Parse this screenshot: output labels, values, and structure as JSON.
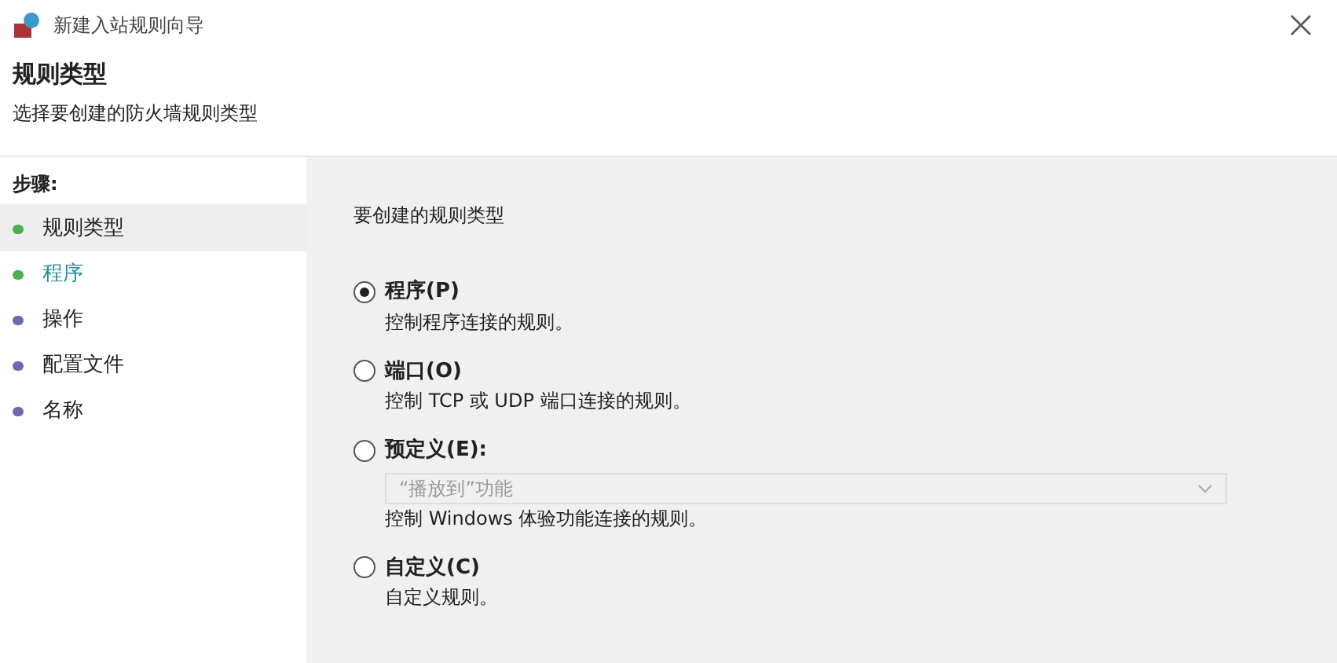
{
  "window": {
    "title": "新建入站规则向导"
  },
  "header": {
    "title": "规则类型",
    "subtitle": "选择要创建的防火墙规则类型"
  },
  "steps": {
    "heading": "步骤:",
    "items": [
      {
        "label": "规则类型",
        "selected": true,
        "active": false,
        "color": "#4caf50"
      },
      {
        "label": "程序",
        "selected": false,
        "active": true,
        "color": "#4caf50"
      },
      {
        "label": "操作",
        "selected": false,
        "active": false,
        "color": "#6a6ab0"
      },
      {
        "label": "配置文件",
        "selected": false,
        "active": false,
        "color": "#6a6ab0"
      },
      {
        "label": "名称",
        "selected": false,
        "active": false,
        "color": "#6a6ab0"
      }
    ]
  },
  "main": {
    "prompt": "要创建的规则类型",
    "options": [
      {
        "label": "程序(P)",
        "description": "控制程序连接的规则。",
        "selected": true
      },
      {
        "label": "端口(O)",
        "description": "控制 TCP 或 UDP 端口连接的规则。",
        "selected": false
      },
      {
        "label": "预定义(E):",
        "description": "控制 Windows 体验功能连接的规则。",
        "selected": false,
        "dropdown": {
          "value": "“播放到”功能",
          "disabled": true
        }
      },
      {
        "label": "自定义(C)",
        "description": "自定义规则。",
        "selected": false
      }
    ]
  }
}
